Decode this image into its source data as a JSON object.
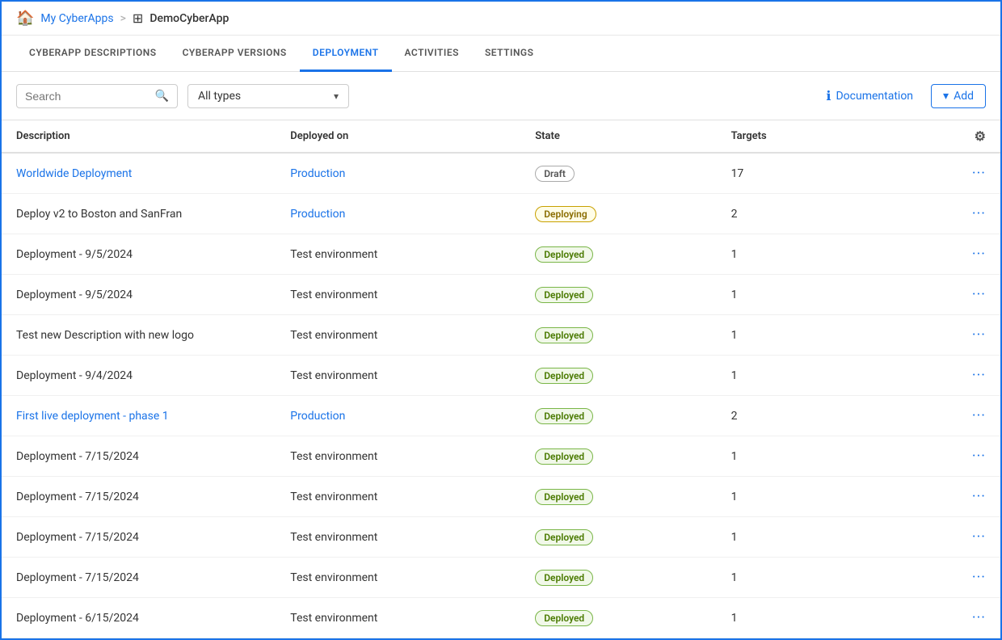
{
  "breadcrumb": {
    "home_label": "My CyberApps",
    "separator": ">",
    "current": "DemoCyberApp"
  },
  "nav": {
    "tabs": [
      {
        "id": "descriptions",
        "label": "CYBERAPP DESCRIPTIONS",
        "active": false
      },
      {
        "id": "versions",
        "label": "CYBERAPP VERSIONS",
        "active": false
      },
      {
        "id": "deployment",
        "label": "DEPLOYMENT",
        "active": true
      },
      {
        "id": "activities",
        "label": "ACTIVITIES",
        "active": false
      },
      {
        "id": "settings",
        "label": "SETTINGS",
        "active": false
      }
    ]
  },
  "toolbar": {
    "search_placeholder": "Search",
    "type_label": "All types",
    "doc_label": "Documentation",
    "add_label": "Add"
  },
  "table": {
    "headers": [
      "Description",
      "Deployed on",
      "State",
      "Targets",
      ""
    ],
    "rows": [
      {
        "description": "Worldwide Deployment",
        "desc_link": true,
        "deployed_on": "Production",
        "deployed_link": true,
        "state": "Draft",
        "state_type": "draft",
        "targets": "17"
      },
      {
        "description": "Deploy v2 to Boston and SanFran",
        "desc_link": false,
        "deployed_on": "Production",
        "deployed_link": true,
        "state": "Deploying",
        "state_type": "deploying",
        "targets": "2"
      },
      {
        "description": "Deployment - 9/5/2024",
        "desc_link": false,
        "deployed_on": "Test environment",
        "deployed_link": false,
        "state": "Deployed",
        "state_type": "deployed",
        "targets": "1"
      },
      {
        "description": "Deployment - 9/5/2024",
        "desc_link": false,
        "deployed_on": "Test environment",
        "deployed_link": false,
        "state": "Deployed",
        "state_type": "deployed",
        "targets": "1"
      },
      {
        "description": "Test new Description with new logo",
        "desc_link": false,
        "deployed_on": "Test environment",
        "deployed_link": false,
        "state": "Deployed",
        "state_type": "deployed",
        "targets": "1"
      },
      {
        "description": "Deployment - 9/4/2024",
        "desc_link": false,
        "deployed_on": "Test environment",
        "deployed_link": false,
        "state": "Deployed",
        "state_type": "deployed",
        "targets": "1"
      },
      {
        "description": "First live deployment - phase 1",
        "desc_link": true,
        "deployed_on": "Production",
        "deployed_link": true,
        "state": "Deployed",
        "state_type": "deployed",
        "targets": "2"
      },
      {
        "description": "Deployment - 7/15/2024",
        "desc_link": false,
        "deployed_on": "Test environment",
        "deployed_link": false,
        "state": "Deployed",
        "state_type": "deployed",
        "targets": "1"
      },
      {
        "description": "Deployment - 7/15/2024",
        "desc_link": false,
        "deployed_on": "Test environment",
        "deployed_link": false,
        "state": "Deployed",
        "state_type": "deployed",
        "targets": "1"
      },
      {
        "description": "Deployment - 7/15/2024",
        "desc_link": false,
        "deployed_on": "Test environment",
        "deployed_link": false,
        "state": "Deployed",
        "state_type": "deployed",
        "targets": "1"
      },
      {
        "description": "Deployment - 7/15/2024",
        "desc_link": false,
        "deployed_on": "Test environment",
        "deployed_link": false,
        "state": "Deployed",
        "state_type": "deployed",
        "targets": "1"
      },
      {
        "description": "Deployment - 6/15/2024",
        "desc_link": false,
        "deployed_on": "Test environment",
        "deployed_link": false,
        "state": "Deployed",
        "state_type": "deployed",
        "targets": "1"
      }
    ]
  }
}
